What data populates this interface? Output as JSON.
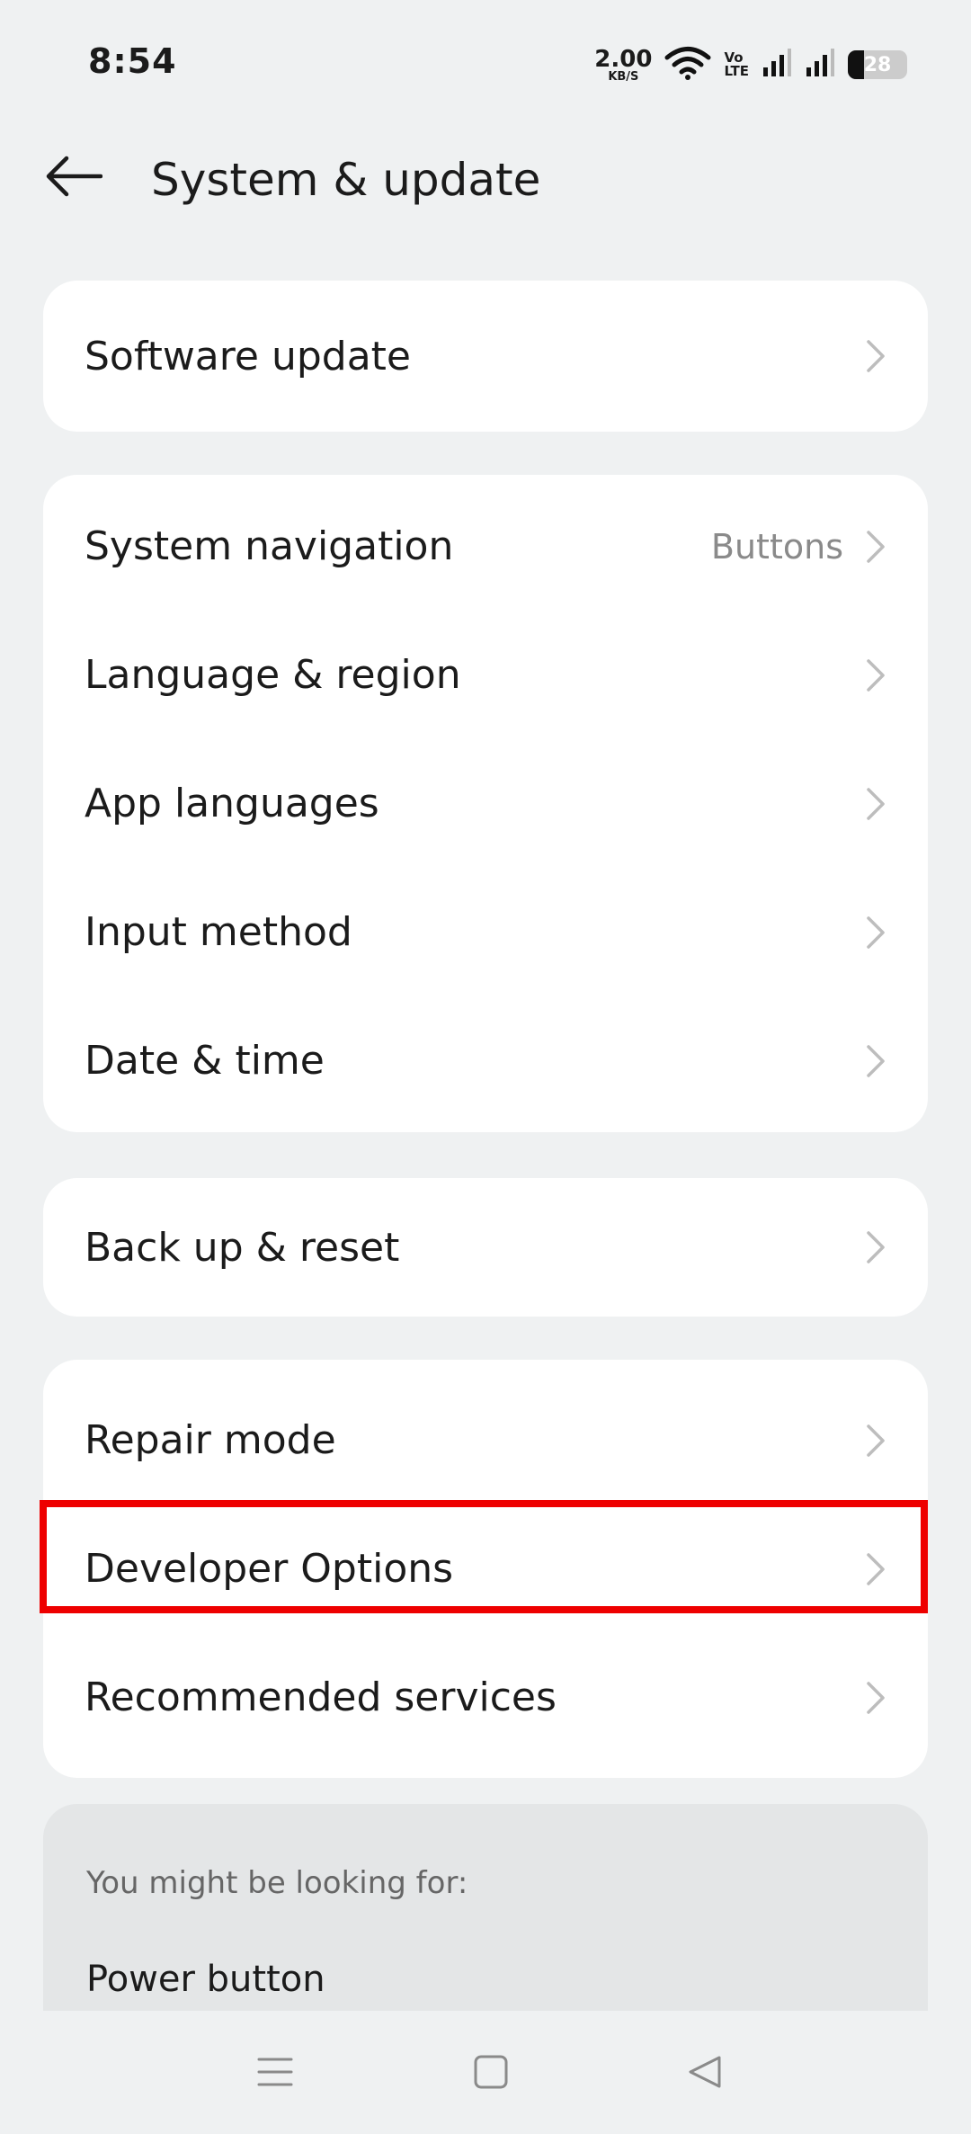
{
  "status_bar": {
    "time": "8:54",
    "net_speed_value": "2.00",
    "net_speed_unit": "KB/S",
    "volte_top": "Vo",
    "volte_bottom": "LTE",
    "battery_level": "28",
    "battery_fraction": 0.28
  },
  "header": {
    "title": "System & update"
  },
  "groups": [
    {
      "items": [
        {
          "label": "Software update"
        }
      ]
    },
    {
      "items": [
        {
          "label": "System navigation",
          "value": "Buttons"
        },
        {
          "label": "Language & region"
        },
        {
          "label": "App languages"
        },
        {
          "label": "Input method"
        },
        {
          "label": "Date & time"
        }
      ]
    },
    {
      "items": [
        {
          "label": "Back up & reset"
        }
      ]
    },
    {
      "items": [
        {
          "label": "Repair mode"
        },
        {
          "label": "Developer Options"
        },
        {
          "label": "Recommended services"
        }
      ]
    }
  ],
  "suggestions": {
    "heading": "You might be looking for:",
    "items": [
      "Power button"
    ]
  },
  "colors": {
    "background": "#eff1f2",
    "card": "#ffffff",
    "highlight": "#ee0000",
    "secondary_text": "#8a8a8a"
  },
  "icons": {
    "back": "arrow-left-icon",
    "chevron": "chevron-right-icon",
    "nav_recents": "menu-lines-icon",
    "nav_home": "square-icon",
    "nav_back": "triangle-left-icon"
  }
}
